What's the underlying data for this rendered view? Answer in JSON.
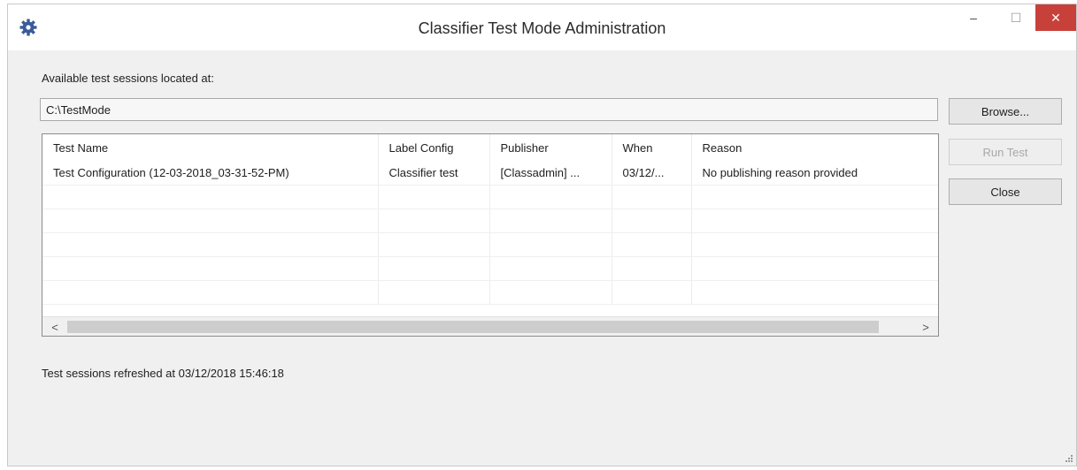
{
  "window": {
    "title": "Classifier Test Mode Administration",
    "icon": "gear-icon",
    "controls": {
      "minimize": "–",
      "maximize": "☐",
      "close": "✕"
    }
  },
  "location": {
    "label": "Available test sessions located at:",
    "path": "C:\\TestMode"
  },
  "buttons": {
    "browse": "Browse...",
    "run_test": "Run Test",
    "close": "Close"
  },
  "table": {
    "columns": [
      "Test Name",
      "Label Config",
      "Publisher",
      "When",
      "Reason"
    ],
    "rows": [
      [
        "Test Configuration (12-03-2018_03-31-52-PM)",
        "Classifier test",
        "[Classadmin] ...",
        "03/12/...",
        "No publishing reason provided"
      ]
    ]
  },
  "scrollbar": {
    "left": "<",
    "right": ">"
  },
  "status": "Test sessions refreshed at 03/12/2018 15:46:18",
  "colors": {
    "close_button": "#c7413a",
    "accent_icon": "#3a5b9a"
  }
}
